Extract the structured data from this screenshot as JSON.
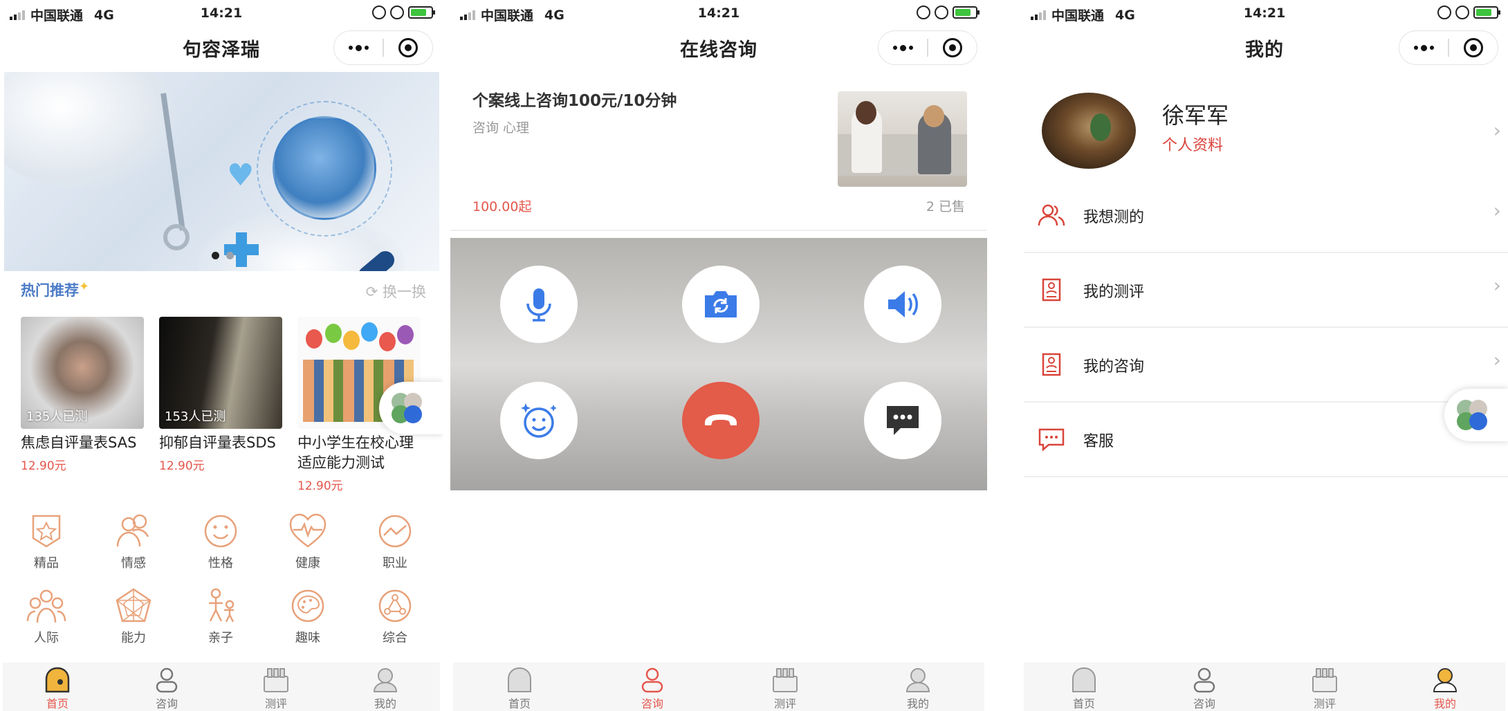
{
  "status": {
    "carrier": "中国联通",
    "network": "4G",
    "time": "14:21"
  },
  "tabbar": {
    "items": [
      "首页",
      "咨询",
      "测评",
      "我的"
    ]
  },
  "home": {
    "title": "句容泽瑞",
    "section_title": "热门推荐",
    "refresh_label": "换一换",
    "cards": [
      {
        "count": "135人已测",
        "name": "焦虑自评量表SAS",
        "price": "12.90元"
      },
      {
        "count": "153人已测",
        "name": "抑郁自评量表SDS",
        "price": "12.90元"
      },
      {
        "count": "",
        "name": "中小学生在校心理适应能力测试",
        "price": "12.90元"
      }
    ],
    "categories": [
      "精品",
      "情感",
      "性格",
      "健康",
      "职业",
      "人际",
      "能力",
      "亲子",
      "趣味",
      "综合"
    ]
  },
  "consult": {
    "title": "在线咨询",
    "product": {
      "name": "个案线上咨询100元/10分钟",
      "tags": "咨询 心理",
      "price": "100.00起",
      "sold": "2 已售"
    }
  },
  "mine": {
    "title": "我的",
    "username": "徐军军",
    "profile_link": "个人资料",
    "menu": [
      "我想测的",
      "我的测评",
      "我的咨询",
      "客服"
    ]
  },
  "colors": {
    "accent": "#e4574c",
    "icon_orange": "#e8a27a",
    "link_blue": "#4c7cc7",
    "video_button_blue": "#3b7be8"
  }
}
